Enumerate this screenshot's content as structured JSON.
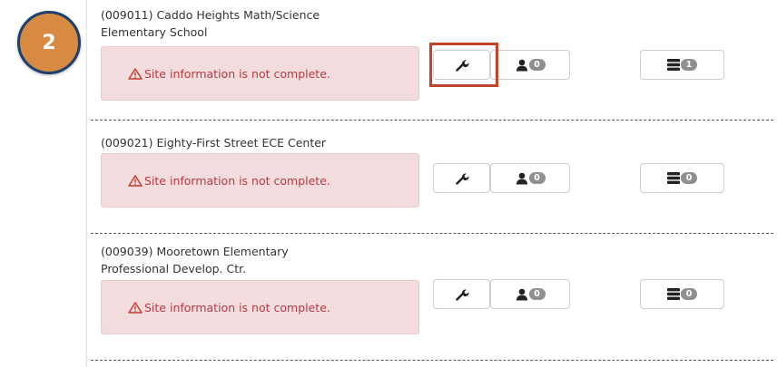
{
  "step_badge": "2",
  "colors": {
    "alert_background": "#f3dcde",
    "alert_text": "#b53b42",
    "step_badge_fill": "#d68a42",
    "step_badge_border": "#1c3f6e",
    "highlight_border": "#c1432c",
    "count_badge": "#8f8f8f"
  },
  "sites": [
    {
      "name_lines": [
        "(009011) Caddo Heights Math/Science",
        "Elementary School"
      ],
      "alert": "Site information is not complete.",
      "wrench_icon": "wrench-icon",
      "user_count": "0",
      "data_count": "1",
      "highlighted": true
    },
    {
      "name_lines": [
        "(009021) Eighty-First Street ECE Center"
      ],
      "alert": "Site information is not complete.",
      "wrench_icon": "wrench-icon",
      "user_count": "0",
      "data_count": "0",
      "highlighted": false
    },
    {
      "name_lines": [
        "(009039) Mooretown Elementary",
        "Professional Develop. Ctr."
      ],
      "alert": "Site information is not complete.",
      "wrench_icon": "wrench-icon",
      "user_count": "0",
      "data_count": "0",
      "highlighted": false
    }
  ]
}
